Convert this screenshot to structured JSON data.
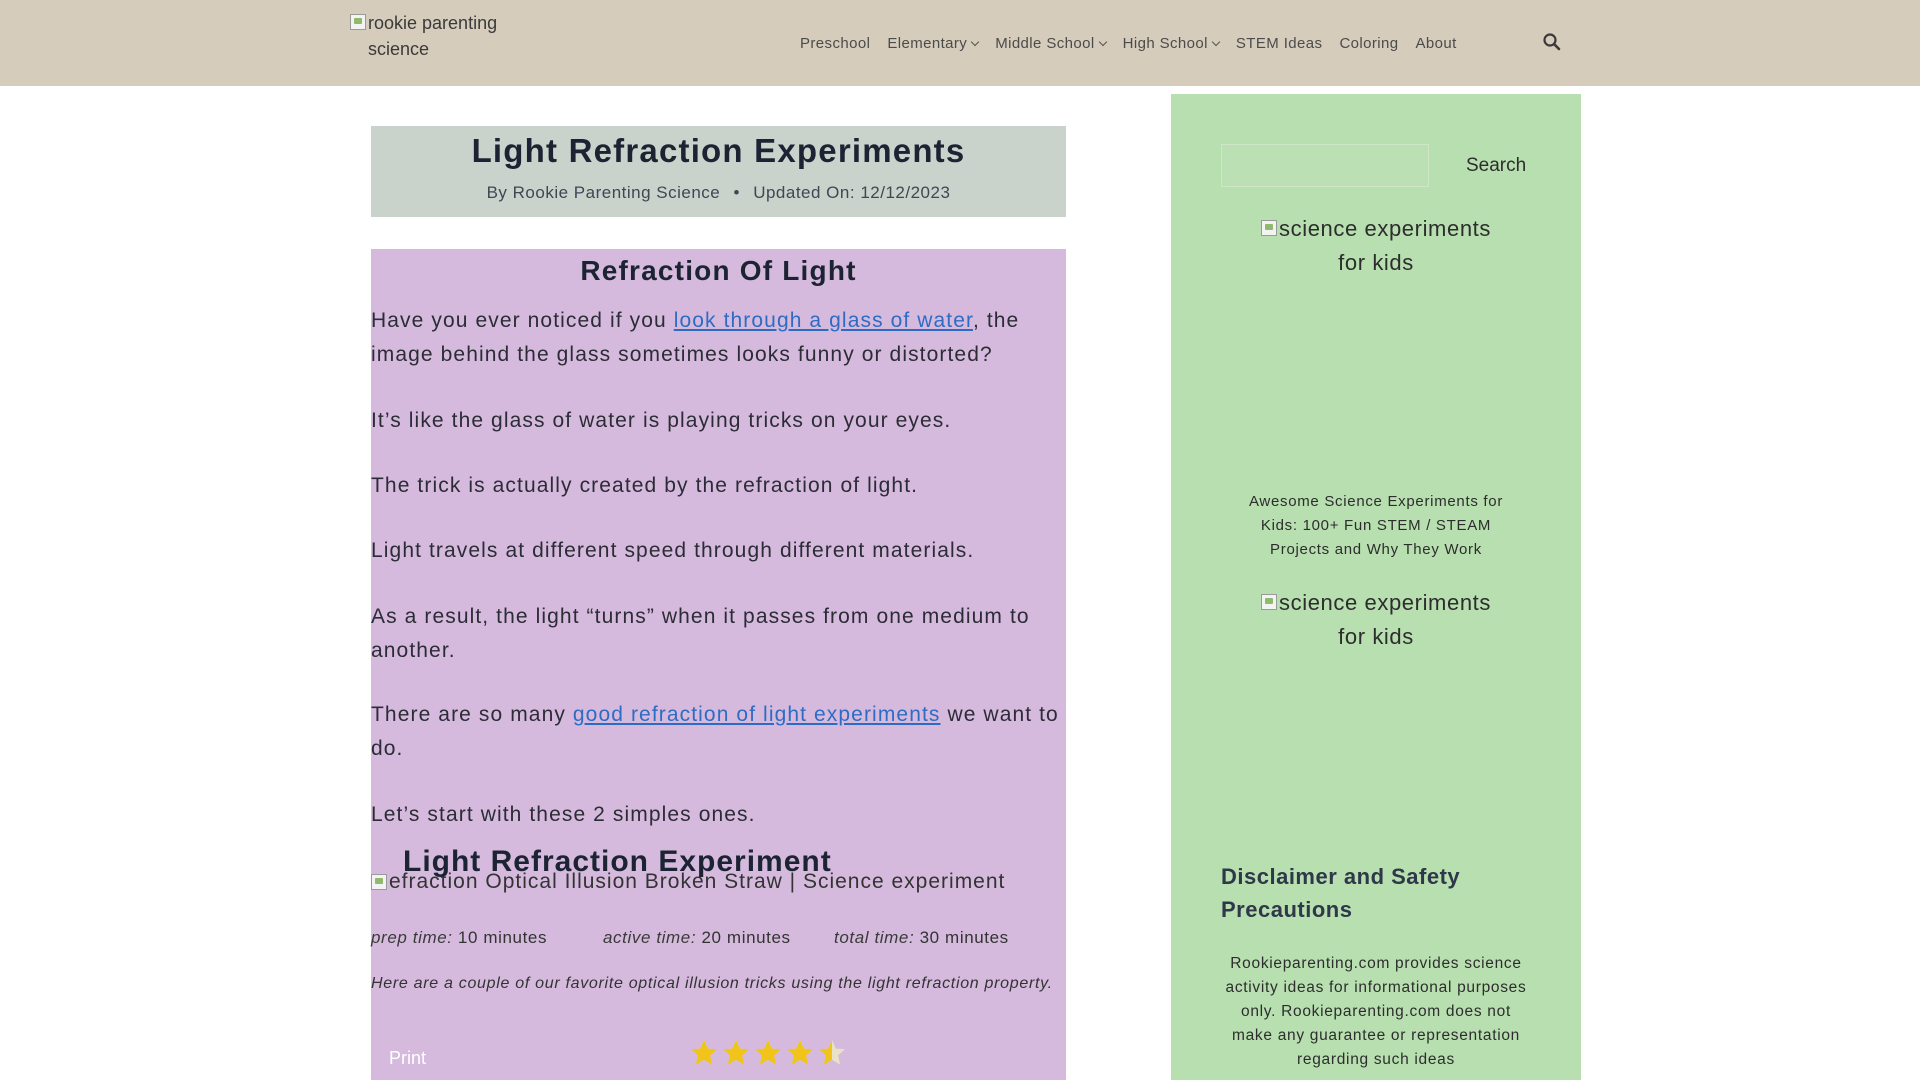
{
  "header": {
    "logo_alt": "rookie parenting science",
    "nav": [
      {
        "label": "Preschool",
        "dropdown": false
      },
      {
        "label": "Elementary",
        "dropdown": true
      },
      {
        "label": "Middle School",
        "dropdown": true
      },
      {
        "label": "High School",
        "dropdown": true
      },
      {
        "label": "STEM Ideas",
        "dropdown": false
      },
      {
        "label": "Coloring",
        "dropdown": false
      },
      {
        "label": "About",
        "dropdown": false
      }
    ],
    "search_icon": "search-icon"
  },
  "post": {
    "title": "Light Refraction Experiments",
    "by_label": "By",
    "author": "Rookie Parenting Science",
    "updated_label": "Updated On:",
    "updated_date": "12/12/2023"
  },
  "article": {
    "heading": "Refraction Of Light",
    "p1_before": "Have you ever noticed if you ",
    "p1_link": "look through a glass of water",
    "p1_after": ", the image behind the glass sometimes looks funny or distorted?",
    "p2": "It’s like the glass of water is playing tricks on your eyes.",
    "p3": "The trick is actually created by the refraction of light.",
    "p4": "Light travels at different speed through different materials.",
    "p5": "As a result, the light “turns” when it passes from one medium to another.",
    "p6_before": "There are so many ",
    "p6_link": "good refraction of light experiments",
    "p6_after": " we want to do.",
    "p7": "Let’s start with these 2 simples ones."
  },
  "recipe": {
    "title": "Light Refraction Experiment",
    "image_alt": "efraction Optical Illusion Broken Straw | Science experiment",
    "prep_label": "prep time:",
    "prep_value": "10 minutes",
    "active_label": "active time:",
    "active_value": "20 minutes",
    "total_label": "total time:",
    "total_value": "30 minutes",
    "summary": "Here are a couple of our favorite optical illusion tricks using the light refraction property.",
    "print_label": "Print",
    "rating": 4.5,
    "rating_max": 5,
    "star_color": "#f0c419"
  },
  "sidebar": {
    "search_placeholder": "",
    "search_button": "Search",
    "image1_alt": "science experiments for kids",
    "book_caption": "Awesome Science Experiments for Kids: 100+ Fun STEM / STEAM Projects and Why They Work",
    "image2_alt": "science experiments for kids",
    "disclaimer_title": "Disclaimer and Safety Precautions",
    "disclaimer_text": "Rookieparenting.com provides science activity ideas for informational purposes only. Rookieparenting.com does not make any guarantee or representation regarding such ideas"
  },
  "colors": {
    "header_bg": "#d6ccbc",
    "title_box_bg": "#cad3cb",
    "article_bg": "#d5bade",
    "sidebar_bg": "#b8dfb0",
    "link": "#2e6cc4"
  }
}
